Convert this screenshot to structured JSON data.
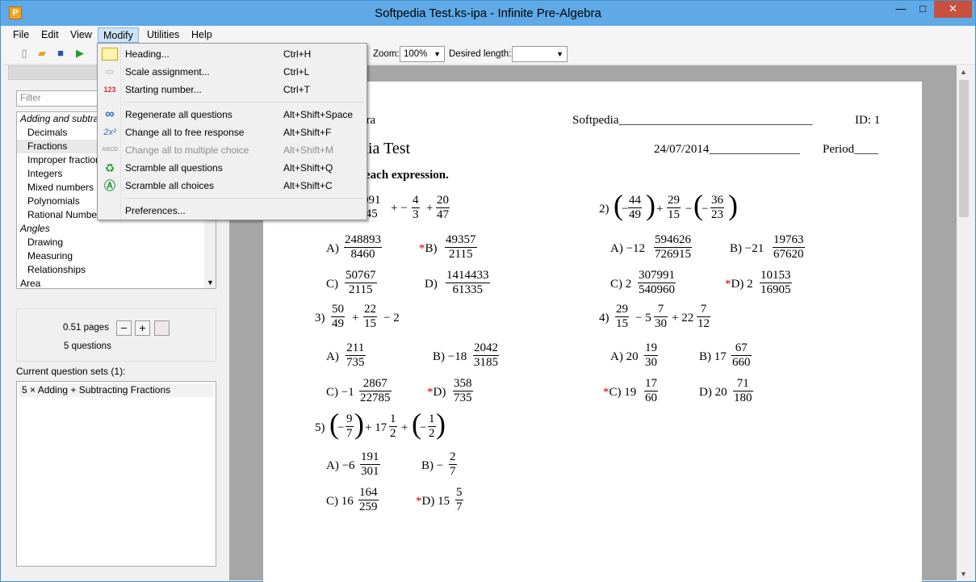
{
  "window": {
    "title": "Softpedia Test.ks-ipa - Infinite Pre-Algebra",
    "min": "—",
    "max": "□",
    "close": "✕",
    "app_icon": "P"
  },
  "menubar": [
    "File",
    "Edit",
    "View",
    "Modify",
    "Utilities",
    "Help"
  ],
  "toolbar": {
    "zoom_label": "Zoom:",
    "zoom_value": "100%",
    "length_label": "Desired length:",
    "length_value": ""
  },
  "left": {
    "filter_placeholder": "Filter",
    "tree": [
      "Adding and subtracting",
      "Decimals",
      "Fractions",
      "Improper fractions",
      "Integers",
      "Mixed numbers",
      "Polynomials",
      "Rational Numbers",
      "Angles",
      "Drawing",
      "Measuring",
      "Relationships",
      "Area"
    ],
    "pages": "0.51 pages",
    "questions": "5 questions",
    "minus": "−",
    "plus": "+",
    "sets_label": "Current question sets (1):",
    "set_item": "5 × Adding + Subtracting Fractions"
  },
  "modify_menu": {
    "items": [
      {
        "label": "Heading...",
        "shortcut": "Ctrl+H",
        "icon": "heading-icon"
      },
      {
        "label": "Scale assignment...",
        "shortcut": "Ctrl+L",
        "icon": "scale-icon"
      },
      {
        "label": "Starting number...",
        "shortcut": "Ctrl+T",
        "icon": "numbers-icon",
        "glyph": "123"
      },
      {
        "label": "Regenerate all questions",
        "shortcut": "Alt+Shift+Space",
        "icon": "infinity-icon",
        "glyph": "∞"
      },
      {
        "label": "Change all to free response",
        "shortcut": "Alt+Shift+F",
        "icon": "free-response-icon",
        "glyph": "2x²"
      },
      {
        "label": "Change all to multiple choice",
        "shortcut": "Alt+Shift+M",
        "icon": "multiple-choice-icon",
        "glyph": "ABCD"
      },
      {
        "label": "Scramble all questions",
        "shortcut": "Alt+Shift+Q",
        "icon": "scramble-questions-icon",
        "glyph": "♻"
      },
      {
        "label": "Scramble all choices",
        "shortcut": "Alt+Shift+C",
        "icon": "scramble-choices-icon",
        "glyph": "Ⓐ"
      },
      {
        "label": "Preferences...",
        "shortcut": "",
        "icon": ""
      }
    ]
  },
  "worksheet": {
    "header_left": "bra",
    "name_line": "Softpedia________________________________",
    "id": "ID: 1",
    "title": "dia Test",
    "date_line": "24/07/2014_______________",
    "period": "Period____",
    "instructions": "each expression.",
    "q1": {
      "num_top": "091",
      "den_top": "45",
      "op1": "+ −",
      "f2n": "4",
      "f2d": "3",
      "op2": "+",
      "f3n": "20",
      "f3d": "47",
      "A": "A)",
      "An": "248893",
      "Ad": "8460",
      "B": "B)",
      "Bn": "49357",
      "Bd": "2115",
      "C": "C)",
      "Cn": "50767",
      "Cd": "2115",
      "D": "D)",
      "Dn": "1414433",
      "Dd": "61335"
    },
    "q2": {
      "label": "2)",
      "f1n": "44",
      "f1d": "49",
      "f2n": "29",
      "f2d": "15",
      "f3n": "36",
      "f3d": "23",
      "A": "A)",
      "Aw": "−12",
      "An": "594626",
      "Ad": "726915",
      "B": "B)",
      "Bw": "−21",
      "Bn": "19763",
      "Bd": "67620",
      "C": "C)",
      "Cw": "2",
      "Cn": "307991",
      "Cd": "540960",
      "D": "D)",
      "Dw": "2",
      "Dn": "10153",
      "Dd": "16905"
    },
    "q3": {
      "label": "3)",
      "f1n": "50",
      "f1d": "49",
      "f2n": "22",
      "f2d": "15",
      "tail": "− 2",
      "A": "A)",
      "An": "211",
      "Ad": "735",
      "B": "B)",
      "Bw": "−18",
      "Bn": "2042",
      "Bd": "3185",
      "C": "C)",
      "Cw": "−1",
      "Cn": "2867",
      "Cd": "22785",
      "D": "D)",
      "Dn": "358",
      "Dd": "735"
    },
    "q4": {
      "label": "4)",
      "f1n": "29",
      "f1d": "15",
      "op1": "− 5",
      "f2n": "7",
      "f2d": "30",
      "op2": "+ 22",
      "f3n": "7",
      "f3d": "12",
      "A": "A)",
      "Aw": "20",
      "An": "19",
      "Ad": "30",
      "B": "B)",
      "Bw": "17",
      "Bn": "67",
      "Bd": "660",
      "C": "C)",
      "Cw": "19",
      "Cn": "17",
      "Cd": "60",
      "D": "D)",
      "Dw": "20",
      "Dn": "71",
      "Dd": "180"
    },
    "q5": {
      "label": "5)",
      "f1n": "9",
      "f1d": "7",
      "op1": "+ 17",
      "f2n": "1",
      "f2d": "2",
      "f3n": "1",
      "f3d": "2",
      "A": "A)",
      "Aw": "−6",
      "An": "191",
      "Ad": "301",
      "B": "B)",
      "Bw": "−",
      "Bn": "2",
      "Bd": "7",
      "C": "C)",
      "Cw": "16",
      "Cn": "164",
      "Cd": "259",
      "D": "D)",
      "Dw": "15",
      "Dn": "5",
      "Dd": "7"
    },
    "star": "*"
  }
}
